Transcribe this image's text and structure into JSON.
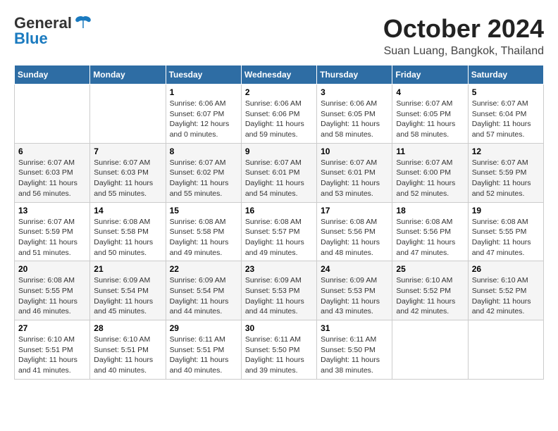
{
  "header": {
    "logo_general": "General",
    "logo_blue": "Blue",
    "month_title": "October 2024",
    "location": "Suan Luang, Bangkok, Thailand"
  },
  "weekdays": [
    "Sunday",
    "Monday",
    "Tuesday",
    "Wednesday",
    "Thursday",
    "Friday",
    "Saturday"
  ],
  "weeks": [
    [
      {
        "day": "",
        "info": ""
      },
      {
        "day": "",
        "info": ""
      },
      {
        "day": "1",
        "info": "Sunrise: 6:06 AM\nSunset: 6:07 PM\nDaylight: 12 hours\nand 0 minutes."
      },
      {
        "day": "2",
        "info": "Sunrise: 6:06 AM\nSunset: 6:06 PM\nDaylight: 11 hours\nand 59 minutes."
      },
      {
        "day": "3",
        "info": "Sunrise: 6:06 AM\nSunset: 6:05 PM\nDaylight: 11 hours\nand 58 minutes."
      },
      {
        "day": "4",
        "info": "Sunrise: 6:07 AM\nSunset: 6:05 PM\nDaylight: 11 hours\nand 58 minutes."
      },
      {
        "day": "5",
        "info": "Sunrise: 6:07 AM\nSunset: 6:04 PM\nDaylight: 11 hours\nand 57 minutes."
      }
    ],
    [
      {
        "day": "6",
        "info": "Sunrise: 6:07 AM\nSunset: 6:03 PM\nDaylight: 11 hours\nand 56 minutes."
      },
      {
        "day": "7",
        "info": "Sunrise: 6:07 AM\nSunset: 6:03 PM\nDaylight: 11 hours\nand 55 minutes."
      },
      {
        "day": "8",
        "info": "Sunrise: 6:07 AM\nSunset: 6:02 PM\nDaylight: 11 hours\nand 55 minutes."
      },
      {
        "day": "9",
        "info": "Sunrise: 6:07 AM\nSunset: 6:01 PM\nDaylight: 11 hours\nand 54 minutes."
      },
      {
        "day": "10",
        "info": "Sunrise: 6:07 AM\nSunset: 6:01 PM\nDaylight: 11 hours\nand 53 minutes."
      },
      {
        "day": "11",
        "info": "Sunrise: 6:07 AM\nSunset: 6:00 PM\nDaylight: 11 hours\nand 52 minutes."
      },
      {
        "day": "12",
        "info": "Sunrise: 6:07 AM\nSunset: 5:59 PM\nDaylight: 11 hours\nand 52 minutes."
      }
    ],
    [
      {
        "day": "13",
        "info": "Sunrise: 6:07 AM\nSunset: 5:59 PM\nDaylight: 11 hours\nand 51 minutes."
      },
      {
        "day": "14",
        "info": "Sunrise: 6:08 AM\nSunset: 5:58 PM\nDaylight: 11 hours\nand 50 minutes."
      },
      {
        "day": "15",
        "info": "Sunrise: 6:08 AM\nSunset: 5:58 PM\nDaylight: 11 hours\nand 49 minutes."
      },
      {
        "day": "16",
        "info": "Sunrise: 6:08 AM\nSunset: 5:57 PM\nDaylight: 11 hours\nand 49 minutes."
      },
      {
        "day": "17",
        "info": "Sunrise: 6:08 AM\nSunset: 5:56 PM\nDaylight: 11 hours\nand 48 minutes."
      },
      {
        "day": "18",
        "info": "Sunrise: 6:08 AM\nSunset: 5:56 PM\nDaylight: 11 hours\nand 47 minutes."
      },
      {
        "day": "19",
        "info": "Sunrise: 6:08 AM\nSunset: 5:55 PM\nDaylight: 11 hours\nand 47 minutes."
      }
    ],
    [
      {
        "day": "20",
        "info": "Sunrise: 6:08 AM\nSunset: 5:55 PM\nDaylight: 11 hours\nand 46 minutes."
      },
      {
        "day": "21",
        "info": "Sunrise: 6:09 AM\nSunset: 5:54 PM\nDaylight: 11 hours\nand 45 minutes."
      },
      {
        "day": "22",
        "info": "Sunrise: 6:09 AM\nSunset: 5:54 PM\nDaylight: 11 hours\nand 44 minutes."
      },
      {
        "day": "23",
        "info": "Sunrise: 6:09 AM\nSunset: 5:53 PM\nDaylight: 11 hours\nand 44 minutes."
      },
      {
        "day": "24",
        "info": "Sunrise: 6:09 AM\nSunset: 5:53 PM\nDaylight: 11 hours\nand 43 minutes."
      },
      {
        "day": "25",
        "info": "Sunrise: 6:10 AM\nSunset: 5:52 PM\nDaylight: 11 hours\nand 42 minutes."
      },
      {
        "day": "26",
        "info": "Sunrise: 6:10 AM\nSunset: 5:52 PM\nDaylight: 11 hours\nand 42 minutes."
      }
    ],
    [
      {
        "day": "27",
        "info": "Sunrise: 6:10 AM\nSunset: 5:51 PM\nDaylight: 11 hours\nand 41 minutes."
      },
      {
        "day": "28",
        "info": "Sunrise: 6:10 AM\nSunset: 5:51 PM\nDaylight: 11 hours\nand 40 minutes."
      },
      {
        "day": "29",
        "info": "Sunrise: 6:11 AM\nSunset: 5:51 PM\nDaylight: 11 hours\nand 40 minutes."
      },
      {
        "day": "30",
        "info": "Sunrise: 6:11 AM\nSunset: 5:50 PM\nDaylight: 11 hours\nand 39 minutes."
      },
      {
        "day": "31",
        "info": "Sunrise: 6:11 AM\nSunset: 5:50 PM\nDaylight: 11 hours\nand 38 minutes."
      },
      {
        "day": "",
        "info": ""
      },
      {
        "day": "",
        "info": ""
      }
    ]
  ]
}
